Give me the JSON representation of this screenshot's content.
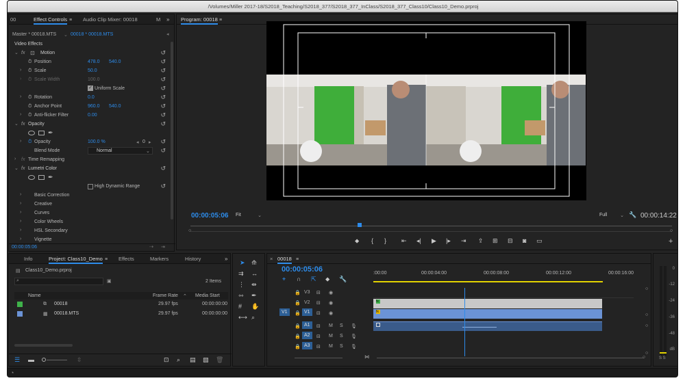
{
  "window": {
    "title": "/Volumes/Miller 2017-18/S2018_Teaching/S2018_377/S2018_377_InClass/S2018_377_Class10/Class10_Demo.prproj"
  },
  "effect_panel": {
    "tab_left": "00",
    "tab_effect_controls": "Effect Controls",
    "tab_audio_mixer": "Audio Clip Mixer: 00018",
    "tab_m": "M",
    "master_label": "Master * 00018.MTS",
    "clip_label": "00018 * 00018.MTS",
    "section_video_effects": "Video Effects",
    "motion": "Motion",
    "position_label": "Position",
    "position_x": "478.0",
    "position_y": "540.0",
    "scale_label": "Scale",
    "scale_value": "50.0",
    "scale_width_label": "Scale Width",
    "scale_width_value": "100.0",
    "uniform_scale": "Uniform Scale",
    "rotation_label": "Rotation",
    "rotation_value": "0.0",
    "anchor_label": "Anchor Point",
    "anchor_x": "960.0",
    "anchor_y": "540.0",
    "antiflicker_label": "Anti-flicker Filter",
    "antiflicker_value": "0.00",
    "opacity_section": "Opacity",
    "opacity_label": "Opacity",
    "opacity_value": "100.0 %",
    "opacity_kf": "0",
    "blend_label": "Blend Mode",
    "blend_value": "Normal",
    "time_remap": "Time Remapping",
    "lumetri": "Lumetri Color",
    "hdr": "High Dynamic Range",
    "basic": "Basic Correction",
    "creative": "Creative",
    "curves": "Curves",
    "wheels": "Color Wheels",
    "hsl": "HSL Secondary",
    "vignette": "Vignette",
    "timecode": "00:00:05:06"
  },
  "program": {
    "title": "Program: 00018",
    "timecode": "00:00:05:06",
    "fit": "Fit",
    "full": "Full",
    "duration": "00:00:14:22"
  },
  "project": {
    "tab_info": "Info",
    "tab_project": "Project: Class10_Demo",
    "tab_effects": "Effects",
    "tab_markers": "Markers",
    "tab_history": "History",
    "filename": "Class10_Demo.prproj",
    "items_count": "2 Items",
    "col_name": "Name",
    "col_frame_rate": "Frame Rate",
    "col_media_start": "Media Start",
    "rows": [
      {
        "name": "00018",
        "rate": "29.97 fps",
        "start": "00:00:00:00",
        "color": "#3fb24a"
      },
      {
        "name": "00018.MTS",
        "rate": "29.97 fps",
        "start": "00:00:00:00",
        "color": "#6b93d6"
      }
    ]
  },
  "timeline": {
    "tab": "00018",
    "timecode": "00:00:05:06",
    "ruler": [
      ":00:00",
      "00:00:04:00",
      "00:00:08:00",
      "00:00:12:00",
      "00:00:16:00"
    ],
    "video_tracks": [
      "V3",
      "V2",
      "V1"
    ],
    "source_v": "V1",
    "audio_tracks": [
      "A1",
      "A2",
      "A3"
    ],
    "playhead_fraction": 0.35,
    "clip_end_fraction": 0.88
  },
  "meter": {
    "labels": [
      "0",
      "-12",
      "-24",
      "-36",
      "-48",
      "dB"
    ],
    "solo": "S S"
  },
  "colors": {
    "accent": "#2d8ceb",
    "bg": "#232323",
    "green_screen": "#3fae3a"
  }
}
